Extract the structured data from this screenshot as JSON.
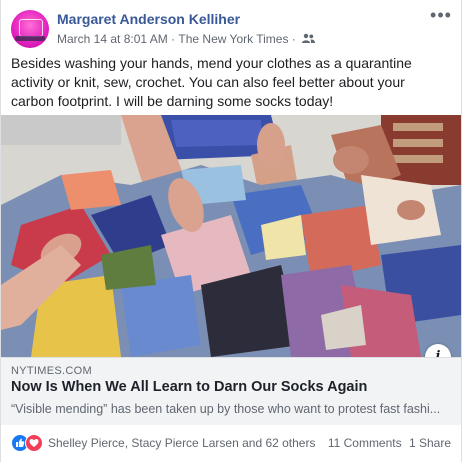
{
  "post": {
    "author": "Margaret Anderson Kelliher",
    "timestamp": "March 14 at 8:01 AM",
    "separator": " · ",
    "via": "The New York Times",
    "audience_icon": "friends-icon",
    "more_icon": "more-options-icon",
    "text": "Besides washing your hands, mend your clothes as a quarantine activity or knit, sew, crochet. You can also feel better about your carbon footprint. I will be darning some socks today!"
  },
  "link_preview": {
    "domain": "NYTIMES.COM",
    "headline": "Now Is When We All Learn to Darn Our Socks Again",
    "description": "“Visible mending” has been taken up by those who want to protest fast fashi...",
    "info_label": "i"
  },
  "footer": {
    "reaction_icons": [
      "like-icon",
      "love-icon"
    ],
    "reactors": "Shelley Pierce, Stacy Pierce Larsen and 62 others",
    "comments": "11 Comments",
    "shares": "1 Share"
  },
  "colors": {
    "link_blue": "#385898",
    "like_blue": "#1877f2",
    "love_red": "#f33e58",
    "avatar_pink": "#e21fbe"
  }
}
